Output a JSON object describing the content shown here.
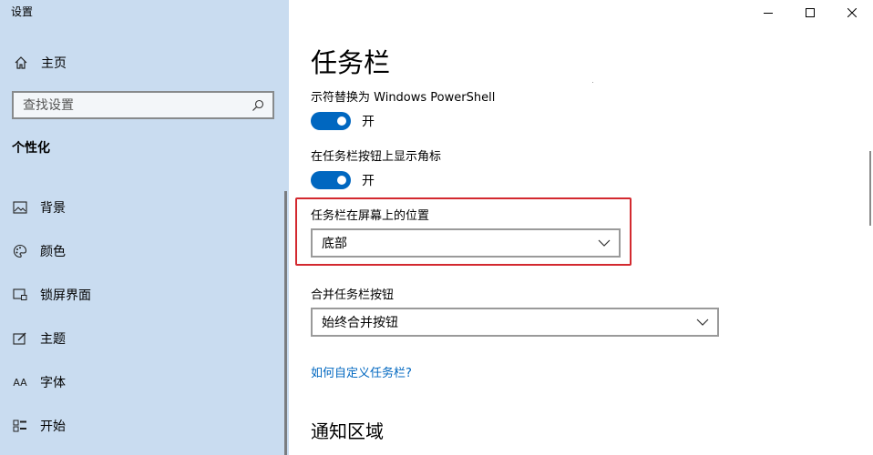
{
  "window": {
    "title": "设置",
    "caption_icons": [
      "minimize-icon",
      "maximize-icon",
      "close-icon"
    ]
  },
  "sidebar": {
    "home": {
      "label": "主页",
      "icon": "home-icon"
    },
    "search": {
      "placeholder": "查找设置",
      "value": "",
      "icon": "search-icon"
    },
    "section_title": "个性化",
    "items": [
      {
        "label": "背景",
        "icon": "background-image-icon"
      },
      {
        "label": "颜色",
        "icon": "palette-icon"
      },
      {
        "label": "锁屏界面",
        "icon": "lock-screen-icon"
      },
      {
        "label": "主题",
        "icon": "theme-brush-icon"
      },
      {
        "label": "字体",
        "icon": "font-icon",
        "glyph": "AA"
      },
      {
        "label": "开始",
        "icon": "start-menu-icon"
      }
    ]
  },
  "main": {
    "title": "任务栏",
    "settings": {
      "powershell": {
        "label": "示符替换为 Windows PowerShell",
        "state": "开",
        "on": true
      },
      "badges": {
        "label": "在任务栏按钮上显示角标",
        "state": "开",
        "on": true
      },
      "position": {
        "label": "任务栏在屏幕上的位置",
        "value": "底部"
      },
      "combine": {
        "label": "合并任务栏按钮",
        "value": "始终合并按钮"
      }
    },
    "link": "如何自定义任务栏?",
    "sub_heading": "通知区域"
  },
  "colors": {
    "sidebar_bg": "#c9dcf0",
    "accent": "#0067c0",
    "highlight_border": "#d3292f"
  }
}
